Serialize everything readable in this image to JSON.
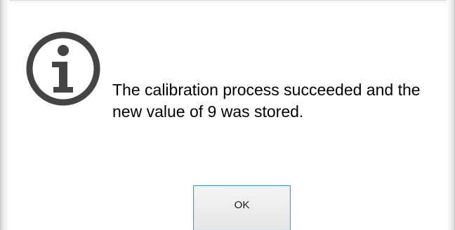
{
  "dialog": {
    "icon": "info-icon",
    "message_line1": "The calibration process succeeded and the",
    "message_line2": "new value of 9 was stored.",
    "ok_label": "OK"
  },
  "colors": {
    "icon": "#444444",
    "button_border": "#4a9ad8",
    "text": "#000000"
  }
}
